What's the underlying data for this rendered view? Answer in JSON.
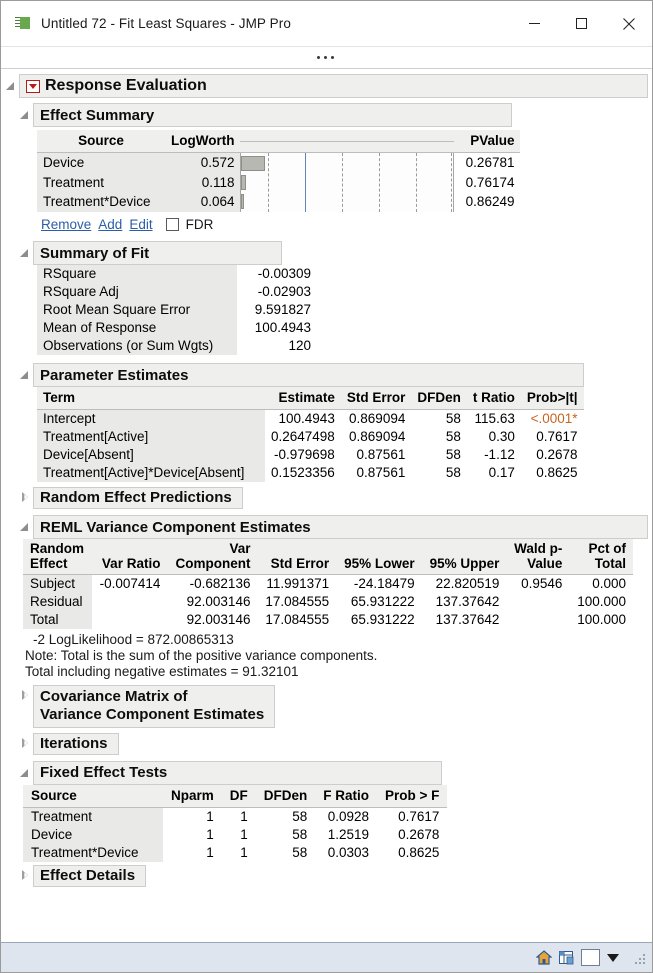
{
  "window": {
    "title": "Untitled 72 - Fit Least Squares - JMP Pro",
    "app_icon": "jmp-flag-icon",
    "minimize_label": "Minimize",
    "maximize_label": "Maximize",
    "close_label": "Close",
    "overflow_label": "..."
  },
  "sections": {
    "response_evaluation": "Response Evaluation",
    "effect_summary": "Effect Summary",
    "summary_of_fit": "Summary of Fit",
    "parameter_estimates": "Parameter Estimates",
    "random_effect_predictions": "Random Effect Predictions",
    "reml_variance": "REML Variance Component Estimates",
    "covariance_matrix_line1": "Covariance Matrix of",
    "covariance_matrix_line2": "Variance Component Estimates",
    "iterations": "Iterations",
    "fixed_effect_tests": "Fixed Effect Tests",
    "effect_details": "Effect Details"
  },
  "effect_summary": {
    "headers": {
      "source": "Source",
      "logworth": "LogWorth",
      "pvalue": "PValue"
    },
    "rows": [
      {
        "source": "Device",
        "logworth": "0.572",
        "pvalue": "0.26781",
        "bar_pct": 11.0
      },
      {
        "source": "Treatment",
        "logworth": "0.118",
        "pvalue": "0.76174",
        "bar_pct": 2.3
      },
      {
        "source": "Treatment*Device",
        "logworth": "0.064",
        "pvalue": "0.86249",
        "bar_pct": 1.3
      }
    ],
    "reference_line_pct": 30.0,
    "gridline_pcts": [
      12.5,
      30.0,
      47.5,
      65.0,
      82.5,
      99.0
    ],
    "actions": {
      "remove": "Remove",
      "add": "Add",
      "edit": "Edit",
      "fdr": "FDR",
      "fdr_checked": false
    }
  },
  "summary_of_fit": {
    "rows": [
      {
        "label": "RSquare",
        "value": "-0.00309"
      },
      {
        "label": "RSquare Adj",
        "value": "-0.02903"
      },
      {
        "label": "Root Mean Square Error",
        "value": "9.591827"
      },
      {
        "label": "Mean of Response",
        "value": "100.4943"
      },
      {
        "label": "Observations (or Sum Wgts)",
        "value": "120"
      }
    ]
  },
  "parameter_estimates": {
    "headers": [
      "Term",
      "Estimate",
      "Std Error",
      "DFDen",
      "t Ratio",
      "Prob>|t|"
    ],
    "rows": [
      {
        "term": "Intercept",
        "estimate": "100.4943",
        "std_error": "0.869094",
        "dfden": "58",
        "t_ratio": "115.63",
        "prob": "<.0001*",
        "significant": true
      },
      {
        "term": "Treatment[Active]",
        "estimate": "0.2647498",
        "std_error": "0.869094",
        "dfden": "58",
        "t_ratio": "0.30",
        "prob": "0.7617",
        "significant": false
      },
      {
        "term": "Device[Absent]",
        "estimate": "-0.979698",
        "std_error": "0.87561",
        "dfden": "58",
        "t_ratio": "-1.12",
        "prob": "0.2678",
        "significant": false
      },
      {
        "term": "Treatment[Active]*Device[Absent]",
        "estimate": "0.1523356",
        "std_error": "0.87561",
        "dfden": "58",
        "t_ratio": "0.17",
        "prob": "0.8625",
        "significant": false
      }
    ]
  },
  "reml": {
    "headers": [
      "Random\nEffect",
      "Var Ratio",
      "Var\nComponent",
      "Std Error",
      "95% Lower",
      "95% Upper",
      "Wald p-\nValue",
      "Pct of\nTotal"
    ],
    "headers_split": [
      {
        "l1": "Random",
        "l2": "Effect"
      },
      {
        "l1": "",
        "l2": "Var Ratio"
      },
      {
        "l1": "Var",
        "l2": "Component"
      },
      {
        "l1": "",
        "l2": "Std Error"
      },
      {
        "l1": "",
        "l2": "95% Lower"
      },
      {
        "l1": "",
        "l2": "95% Upper"
      },
      {
        "l1": "Wald p-",
        "l2": "Value"
      },
      {
        "l1": "Pct of",
        "l2": "Total"
      }
    ],
    "rows": [
      {
        "effect": "Subject",
        "var_ratio": "-0.007414",
        "var_component": "-0.682136",
        "std_error": "11.991371",
        "lower": "-24.18479",
        "upper": "22.820519",
        "wald_p": "0.9546",
        "pct_total": "0.000"
      },
      {
        "effect": "Residual",
        "var_ratio": "",
        "var_component": "92.003146",
        "std_error": "17.084555",
        "lower": "65.931222",
        "upper": "137.37642",
        "wald_p": "",
        "pct_total": "100.000"
      },
      {
        "effect": "Total",
        "var_ratio": "",
        "var_component": "92.003146",
        "std_error": "17.084555",
        "lower": "65.931222",
        "upper": "137.37642",
        "wald_p": "",
        "pct_total": "100.000"
      }
    ],
    "loglikelihood": "-2 LogLikelihood =  872.00865313",
    "note": "Note: Total is the sum of the positive variance components.",
    "total_including_negative": "Total including negative estimates =    91.32101"
  },
  "fixed_effect_tests": {
    "headers": [
      "Source",
      "Nparm",
      "DF",
      "DFDen",
      "F Ratio",
      "Prob > F"
    ],
    "rows": [
      {
        "source": "Treatment",
        "nparm": "1",
        "df": "1",
        "dfden": "58",
        "f_ratio": "0.0928",
        "prob": "0.7617"
      },
      {
        "source": "Device",
        "nparm": "1",
        "df": "1",
        "dfden": "58",
        "f_ratio": "1.2519",
        "prob": "0.2678"
      },
      {
        "source": "Treatment*Device",
        "nparm": "1",
        "df": "1",
        "dfden": "58",
        "f_ratio": "0.0303",
        "prob": "0.8625"
      }
    ]
  },
  "statusbar": {
    "home_icon": "home-icon",
    "grid_icon": "data-grid-icon",
    "color_swatch": "white-color-swatch",
    "dropdown": "caret-down-icon"
  },
  "colors": {
    "header_bg": "#efefee",
    "row_label_bg": "#e9e9e8",
    "link": "#2b5ea8",
    "significant": "#c9641f",
    "reference_line": "#5f87b8",
    "bar_fill": "#b8b8b2",
    "statusbar_bg": "#dfe5ee"
  }
}
